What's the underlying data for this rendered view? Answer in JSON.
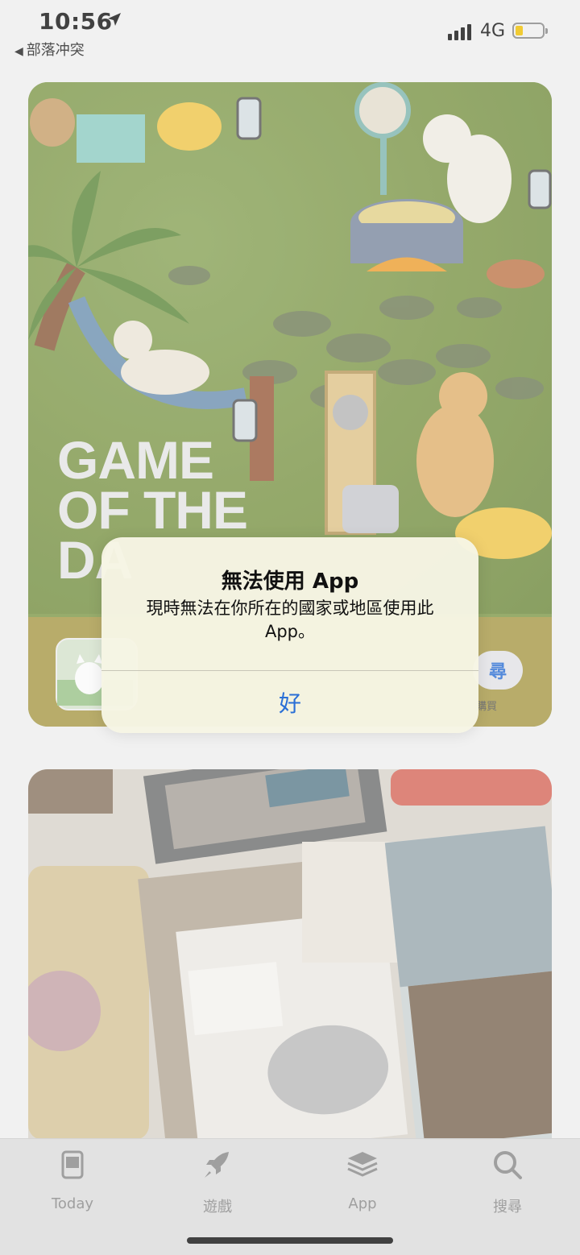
{
  "status_bar": {
    "time": "10:56",
    "back_app": "部落冲突",
    "network": "4G"
  },
  "featured": {
    "headline_lines": [
      "GAME",
      "OF THE",
      "DA"
    ],
    "get_button_partial": "尋",
    "in_app_note": "購買"
  },
  "alert": {
    "title": "無法使用 App",
    "message": "現時無法在你所在的國家或地區使用此 App。",
    "ok_label": "好"
  },
  "tabs": [
    {
      "label": "Today",
      "icon": "today-icon"
    },
    {
      "label": "遊戲",
      "icon": "rocket-icon"
    },
    {
      "label": "App",
      "icon": "layers-icon"
    },
    {
      "label": "搜尋",
      "icon": "search-icon"
    }
  ],
  "colors": {
    "accent": "#2a6fd6",
    "card_green": "#7f9a48",
    "battery_low": "#f2c200"
  }
}
